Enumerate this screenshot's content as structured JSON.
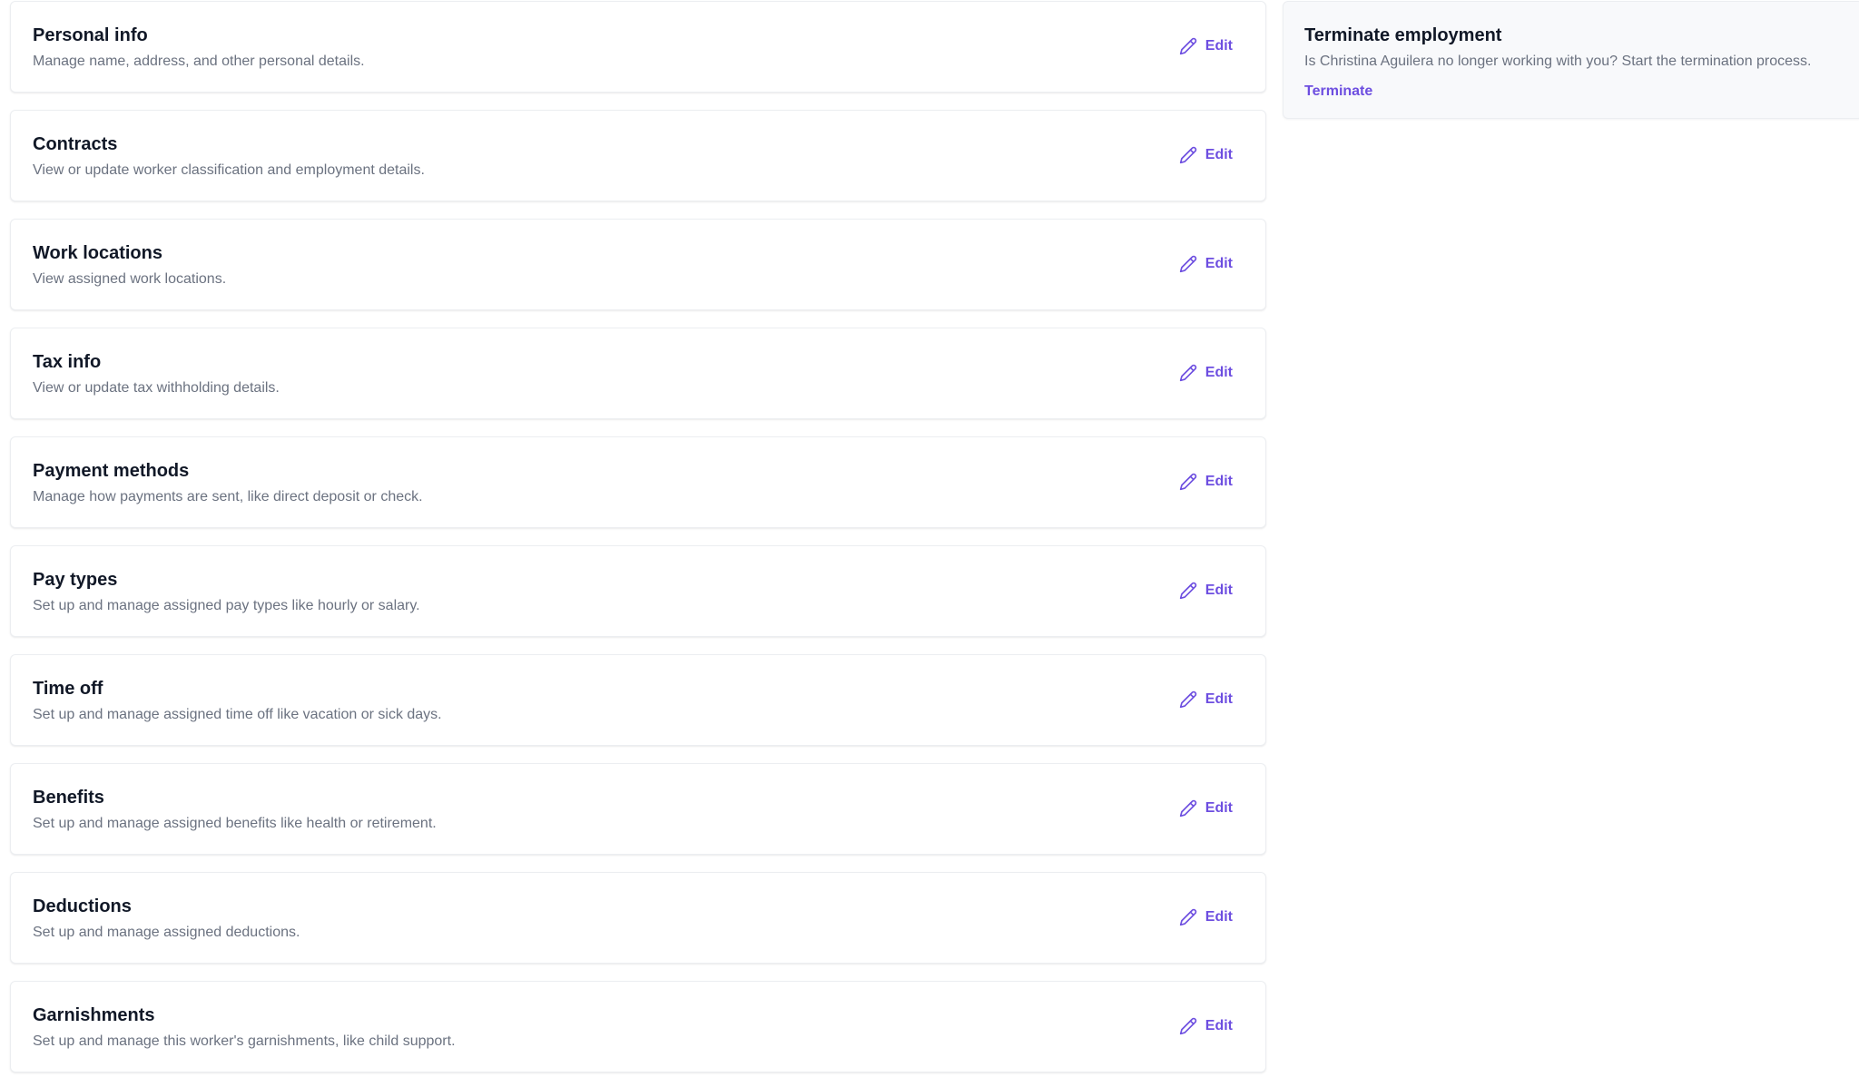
{
  "sections": [
    {
      "title": "Personal info",
      "description": "Manage name, address, and other personal details.",
      "action": "Edit"
    },
    {
      "title": "Contracts",
      "description": "View or update worker classification and employment details.",
      "action": "Edit"
    },
    {
      "title": "Work locations",
      "description": "View assigned work locations.",
      "action": "Edit"
    },
    {
      "title": "Tax info",
      "description": "View or update tax withholding details.",
      "action": "Edit"
    },
    {
      "title": "Payment methods",
      "description": "Manage how payments are sent, like direct deposit or check.",
      "action": "Edit"
    },
    {
      "title": "Pay types",
      "description": "Set up and manage assigned pay types like hourly or salary.",
      "action": "Edit"
    },
    {
      "title": "Time off",
      "description": "Set up and manage assigned time off like vacation or sick days.",
      "action": "Edit"
    },
    {
      "title": "Benefits",
      "description": "Set up and manage assigned benefits like health or retirement.",
      "action": "Edit"
    },
    {
      "title": "Deductions",
      "description": "Set up and manage assigned deductions.",
      "action": "Edit"
    },
    {
      "title": "Garnishments",
      "description": "Set up and manage this worker's garnishments, like child support.",
      "action": "Edit"
    }
  ],
  "terminate": {
    "title": "Terminate employment",
    "description": "Is Christina Aguilera no longer working with you? Start the termination process.",
    "link": "Terminate"
  },
  "icons": {
    "edit": "pencil-icon"
  },
  "colors": {
    "accent": "#6d4ee0",
    "title": "#111827",
    "muted": "#6b7280",
    "side_background": "#f8f9fb"
  }
}
